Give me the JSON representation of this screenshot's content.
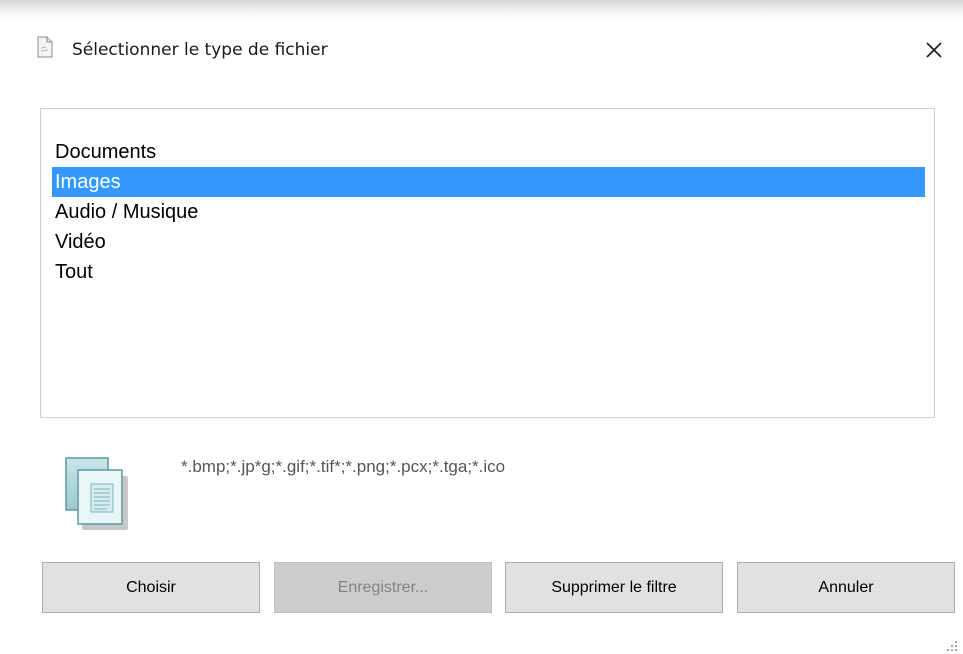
{
  "dialog": {
    "title": "Sélectionner le type de fichier",
    "title_icon": "document-icon",
    "close_icon": "close-icon"
  },
  "file_types": {
    "items": [
      "Documents",
      "Images",
      "Audio / Musique",
      "Vidéo",
      "Tout"
    ],
    "selected": "Images"
  },
  "filter": {
    "icon": "documents-icon",
    "pattern": "*.bmp;*.jp*g;*.gif;*.tif*;*.png;*.pcx;*.tga;*.ico"
  },
  "buttons": {
    "choose": "Choisir",
    "save": "Enregistrer...",
    "remove_filter": "Supprimer le filtre",
    "cancel": "Annuler"
  },
  "colors": {
    "selection": "#3399ff",
    "button_face": "#e1e1e1",
    "button_disabled": "#cccccc"
  }
}
